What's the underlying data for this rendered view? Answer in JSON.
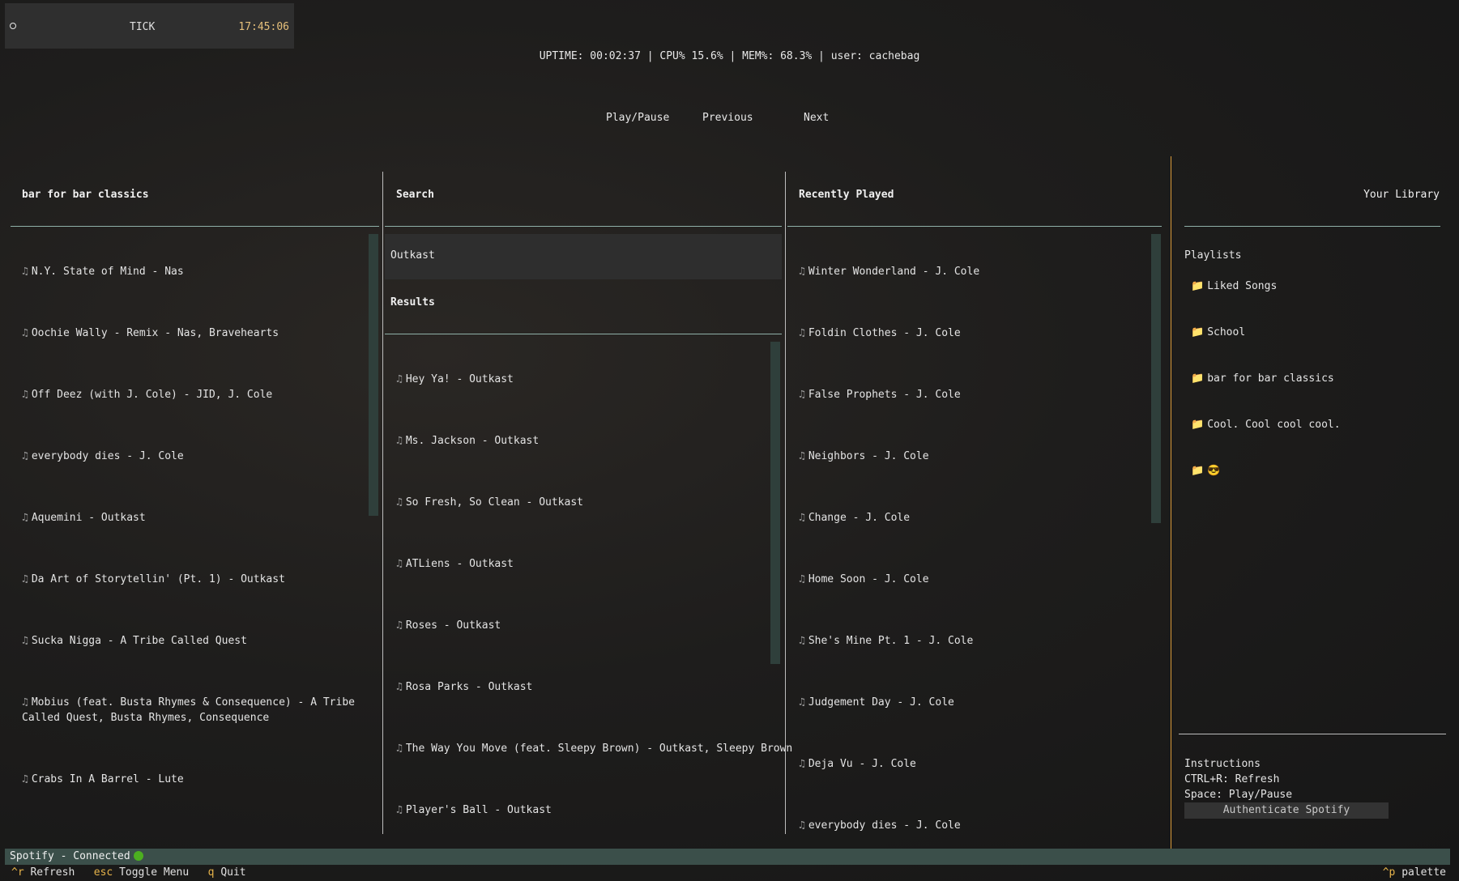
{
  "header": {
    "title": "TICK",
    "time": "17:45:06"
  },
  "stats": "UPTIME: 00:02:37 | CPU% 15.6% | MEM%: 68.3% | user: cachebag",
  "controls": {
    "play_pause": "Play/Pause",
    "previous": "Previous",
    "next": "Next"
  },
  "playlist_panel": {
    "title": "bar for bar classics",
    "tracks": [
      "N.Y. State of Mind - Nas",
      "Oochie Wally - Remix - Nas, Bravehearts",
      "Off Deez (with J. Cole) - JID, J. Cole",
      "everybody dies - J. Cole",
      "Aquemini - Outkast",
      "Da Art of Storytellin' (Pt. 1) - Outkast",
      "Sucka Nigga - A Tribe Called Quest",
      "Mobius (feat. Busta Rhymes & Consequence) - A Tribe",
      "Called Quest, Busta Rhymes, Consequence",
      "Crabs In A Barrel - Lute"
    ]
  },
  "search_panel": {
    "title": "Search",
    "query": "Outkast",
    "results_title": "Results",
    "results": [
      "Hey Ya! - Outkast",
      "Ms. Jackson - Outkast",
      "So Fresh, So Clean - Outkast",
      "ATLiens - Outkast",
      "Roses - Outkast",
      "Rosa Parks - Outkast",
      "The Way You Move (feat. Sleepy Brown) - Outkast, Sleepy Brown",
      "Player's Ball - Outkast"
    ]
  },
  "recent_panel": {
    "title": "Recently Played",
    "tracks": [
      "Winter Wonderland - J. Cole",
      "Foldin Clothes - J. Cole",
      "False Prophets - J. Cole",
      "Neighbors - J. Cole",
      "Change - J. Cole",
      "Home Soon - J. Cole",
      "She's Mine Pt. 1 - J. Cole",
      "Judgement Day - J. Cole",
      "Deja Vu - J. Cole",
      "everybody dies - J. Cole"
    ]
  },
  "library_panel": {
    "title": "Your Library",
    "playlists_label": "Playlists",
    "playlists": [
      "Liked Songs",
      "School",
      "bar for bar classics",
      "Cool. Cool cool cool.",
      "😎"
    ],
    "instructions": [
      "Instructions",
      "CTRL+R: Refresh",
      "Space: Play/Pause"
    ],
    "auth_button": "Authenticate Spotify"
  },
  "status": "Spotify - Connected",
  "footer": {
    "refresh_key": "^r",
    "refresh_label": "Refresh",
    "menu_key": "esc",
    "menu_label": "Toggle Menu",
    "quit_key": "q",
    "quit_label": "Quit",
    "palette_key": "^p",
    "palette_label": "palette"
  },
  "colors": {
    "accent": "#e6b34a",
    "status_bar": "#3b4f4a",
    "divider": "#8fb0a8",
    "connected": "#4caf20"
  }
}
